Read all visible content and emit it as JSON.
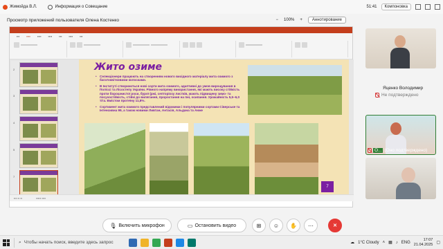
{
  "topbar": {
    "user_name": "Жимойда В.Л.",
    "info_label": "Информация о Совещание",
    "time": "51:41",
    "layout_label": "Компоновка"
  },
  "subbar": {
    "title": "Просмотр приложений пользователя Олена Костенко",
    "zoom_minus": "−",
    "zoom_value": "100%",
    "zoom_plus": "+",
    "annotate_label": "Аннотирование"
  },
  "slide": {
    "title": "Жито озиме",
    "bullets": [
      "Селекціонери працюють на створенням нового вихідного матеріалу жита озимого з багатоквітковими колосками.",
      "В Інституті створюються нові сорти жита озимого, адаптивні до умов вирощування в Поліссі та Лісостепу України. Рівного напряму використання, які мають високу стійкість проти борошнистої роси, бурої (ржі, септоріозу листків, мають підвищену зимо- та посухостійкість, стійкі до вилягання, проростання на пні, осипання. Урожайність 5,5–6,0 т/га. Вмістом протеїну 11,8%.",
      "Сортимент жита озимого представлений відомими і популярними сортами Сіверське та Інтенсивна 99, а також новими Ливтан, Антасія, Альдана та Анже"
    ],
    "page_number": "7"
  },
  "participants": [
    {
      "name": "Яценко Володимир",
      "status": "Не подтверждено"
    },
    {
      "name": "О...",
      "status": "(Оно подтверждено)"
    }
  ],
  "controls": {
    "mic_label": "Включить микрофон",
    "video_label": "Остановить видео",
    "leave_label": "✕"
  },
  "taskbar": {
    "search_placeholder": "Чтобы начать поиск, введите здесь запрос",
    "weather": "1°C  Cloudy",
    "lang": "ENG",
    "time": "17:07",
    "date": "21.04.2025"
  },
  "colors": {
    "accent": "#c43e1c",
    "slide_title": "#7b1fa2",
    "leave": "#e53935"
  }
}
